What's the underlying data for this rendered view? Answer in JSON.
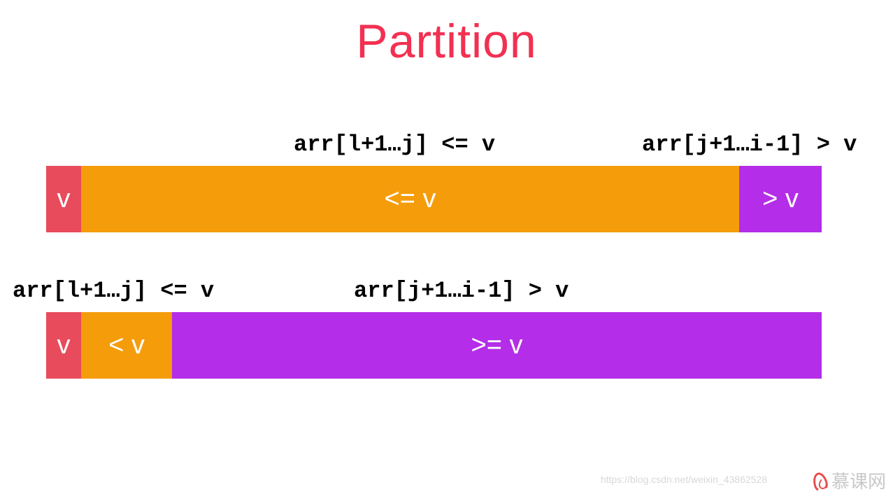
{
  "title": "Partition",
  "colors": {
    "title": "#f23051",
    "pivot": "#e84b5b",
    "orange": "#f59c0b",
    "purple": "#b42de8"
  },
  "section1": {
    "labels": {
      "left": "arr[l+1…j] <= v",
      "right": "arr[j+1…i-1] > v"
    },
    "segments": {
      "pivot": "v",
      "middle": "<= v",
      "right": "> v"
    }
  },
  "section2": {
    "labels": {
      "left": "arr[l+1…j] <= v",
      "right": "arr[j+1…i-1] > v"
    },
    "segments": {
      "pivot": "v",
      "middle": "< v",
      "right": ">= v"
    }
  },
  "watermark": {
    "url": "https://blog.csdn.net/weixin_43862528",
    "logo_text": "慕课网"
  }
}
